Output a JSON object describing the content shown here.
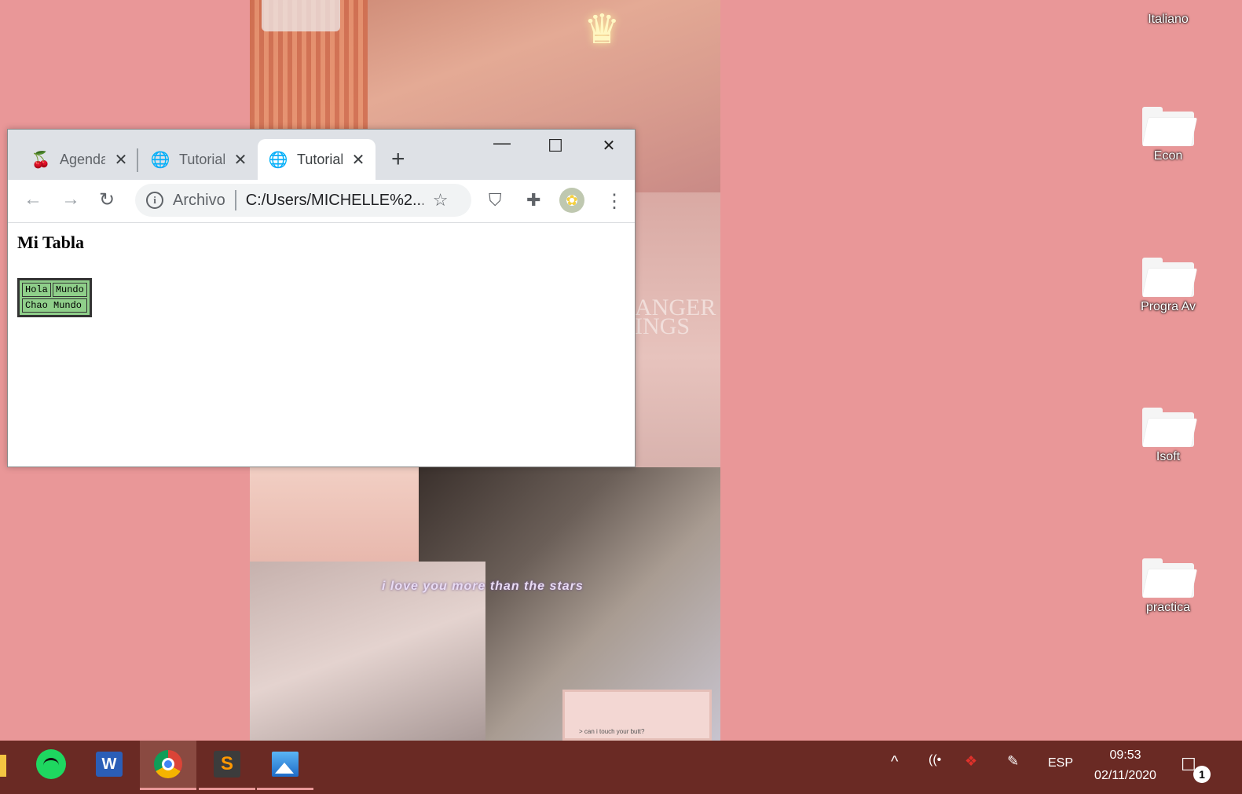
{
  "wallpaper": {
    "caption": "i love you more than the stars",
    "poster_text": "ANGER\nINGS",
    "note_text": "> can i touch your butt?"
  },
  "browser": {
    "tabs": [
      {
        "label": "Agenda",
        "icon": "cherry-icon",
        "glyph": "🍒",
        "close": "✕"
      },
      {
        "label": "Tutorial",
        "icon": "globe-icon",
        "glyph": "🌐",
        "close": "✕"
      },
      {
        "label": "Tutorial",
        "icon": "globe-icon",
        "glyph": "🌐",
        "close": "✕"
      }
    ],
    "new_tab": "+",
    "window_controls": {
      "minimize": "—",
      "maximize": "☐",
      "close": "✕"
    },
    "nav": {
      "back": "←",
      "forward": "→",
      "reload": "↻"
    },
    "omnibox": {
      "info": "i",
      "scheme": "Archivo",
      "url": "C:/Users/MICHELLE%2...",
      "star": "☆"
    },
    "toolbar_icons": {
      "shield": "⛉",
      "extensions": "✚",
      "menu": "⋮",
      "avatar": "✿"
    },
    "page": {
      "title": "Mi Tabla",
      "table": [
        [
          "Hola",
          "Mundo"
        ],
        [
          "Chao Mundo"
        ]
      ]
    }
  },
  "desktop": {
    "top_label": "Italiano",
    "icons": [
      {
        "label": "Econ",
        "icon": "folder-icon"
      },
      {
        "label": "Progra Av",
        "icon": "folder-icon"
      },
      {
        "label": "Isoft",
        "icon": "folder-icon"
      },
      {
        "label": "practica",
        "icon": "folder-icon"
      }
    ]
  },
  "taskbar": {
    "apps": [
      {
        "name": "Spotify",
        "icon": "spotify-icon"
      },
      {
        "name": "Word",
        "icon": "word-icon",
        "glyph": "W"
      },
      {
        "name": "Chrome",
        "icon": "chrome-icon"
      },
      {
        "name": "Sublime Text",
        "icon": "sublime-icon",
        "glyph": "S"
      },
      {
        "name": "Photos",
        "icon": "photos-icon"
      }
    ],
    "tray": {
      "chevron": "^",
      "wifi": "((•",
      "dropbox": "❖",
      "pen": "✎",
      "language": "ESP"
    },
    "time": "09:53",
    "date": "02/11/2020",
    "notification_glyph": "☐",
    "notification_count": "1"
  },
  "colors": {
    "desktop_bg": "#e99798",
    "taskbar_bg": "#6a2a24",
    "table_bg": "#8fcf8a"
  }
}
